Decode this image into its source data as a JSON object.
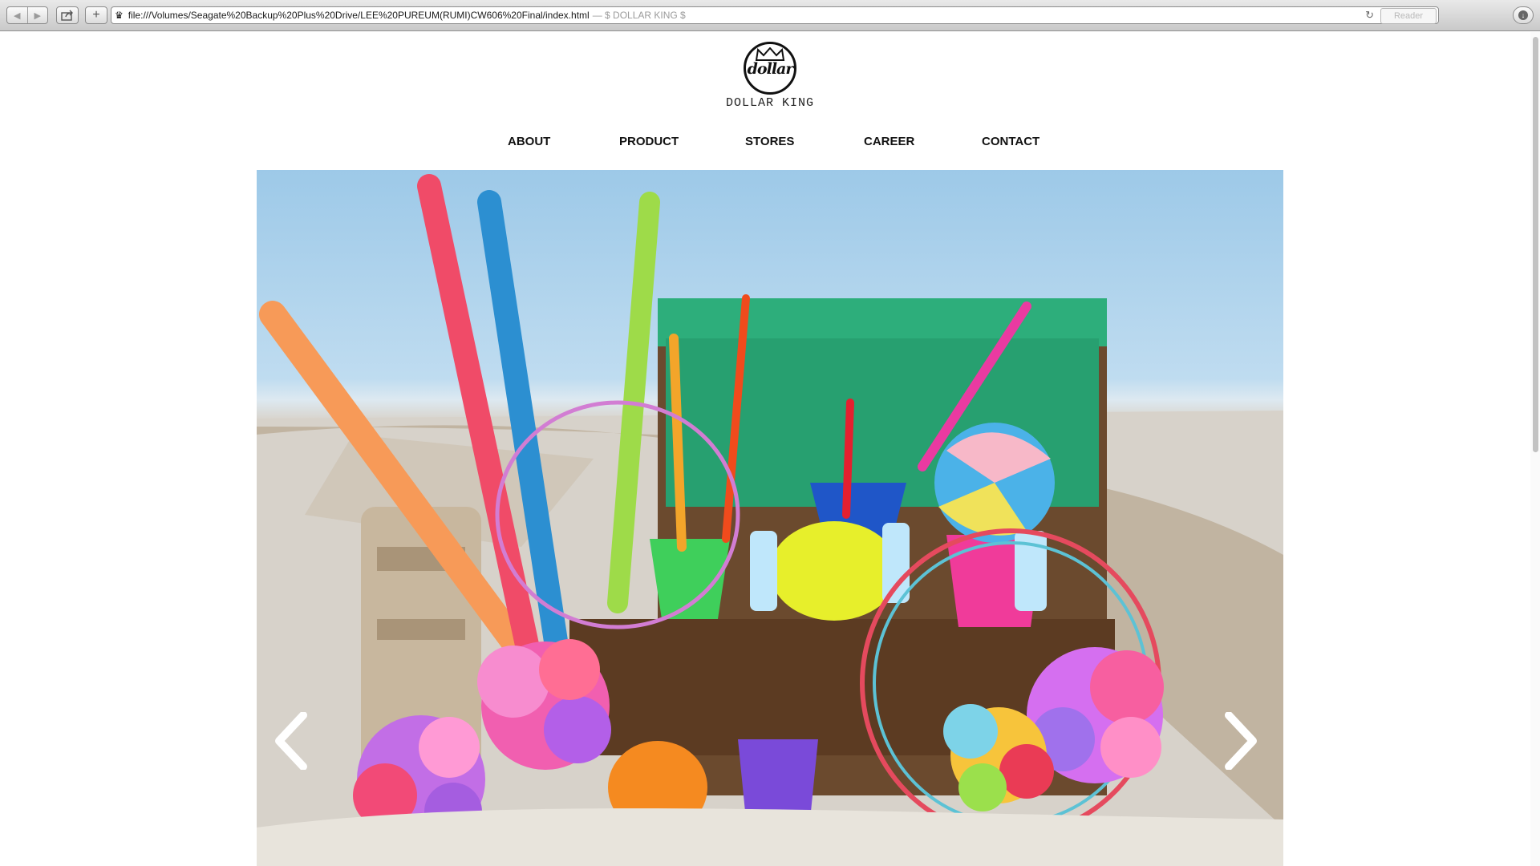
{
  "browser": {
    "url": "file:///Volumes/Seagate%20Backup%20Plus%20Drive/LEE%20PUREUM(RUMI)CW606%20Final/index.html",
    "title_suffix": "— $ DOLLAR KING $",
    "reader_label": "Reader"
  },
  "logo": {
    "script": "dollar",
    "name": "DOLLAR KING"
  },
  "nav": [
    "ABOUT",
    "PRODUCT",
    "STORES",
    "CAREER",
    "CONTACT"
  ],
  "slider": {
    "image_alt": "",
    "prev_icon": "chevron-left-icon",
    "next_icon": "chevron-right-icon"
  },
  "colors": {
    "accent": "#111111",
    "sky": "#9dc9e8",
    "sand": "#d8d3cb"
  }
}
